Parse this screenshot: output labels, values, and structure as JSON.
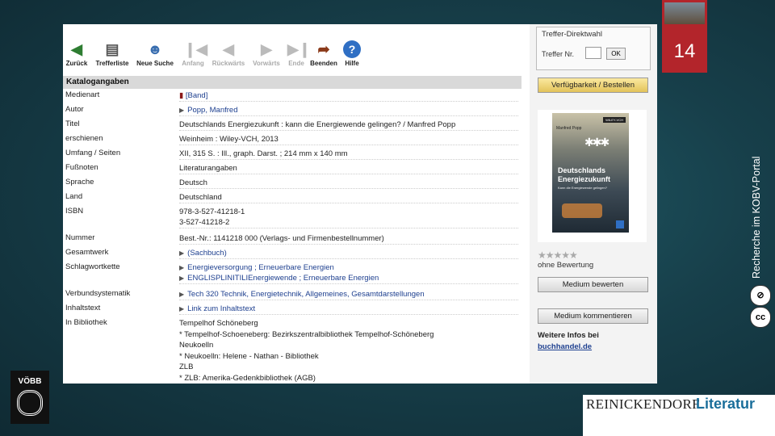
{
  "slide": {
    "number": "14",
    "vertical_text": "Recherche im KOBV-Portal",
    "voebb_logo": "VÖBB",
    "brand": {
      "name": "REINICKENDORF",
      "word": "Literatur",
      "name_color": "#222222",
      "word_color": "#1a6e9a"
    }
  },
  "toolbar": {
    "items": [
      {
        "label": "Zurück",
        "icon": "arrow-left-icon",
        "enabled": true
      },
      {
        "label": "Trefferliste",
        "icon": "list-icon",
        "enabled": true
      },
      {
        "label": "Neue Suche",
        "icon": "people-search-icon",
        "enabled": true
      },
      {
        "label": "Anfang",
        "icon": "first-icon",
        "enabled": false
      },
      {
        "label": "Rückwärts",
        "icon": "prev-icon",
        "enabled": false
      },
      {
        "label": "Vorwärts",
        "icon": "next-icon",
        "enabled": false
      },
      {
        "label": "Ende",
        "icon": "last-icon",
        "enabled": false
      },
      {
        "label": "Beenden",
        "icon": "exit-icon",
        "enabled": true
      },
      {
        "label": "Hilfe",
        "icon": "help-icon",
        "enabled": true
      }
    ]
  },
  "catalog": {
    "heading": "Katalogangaben",
    "rows": [
      {
        "label": "Medienart",
        "values": [
          "[Band]"
        ]
      },
      {
        "label": "Autor",
        "values": [
          "Popp, Manfred"
        ]
      },
      {
        "label": "Titel",
        "values": [
          "Deutschlands Energiezukunft : kann die Energiewende gelingen? / Manfred Popp"
        ]
      },
      {
        "label": "erschienen",
        "values": [
          "Weinheim : Wiley-VCH, 2013"
        ]
      },
      {
        "label": "Umfang / Seiten",
        "values": [
          "XII, 315 S. : Ill., graph. Darst. ; 214 mm x 140 mm"
        ]
      },
      {
        "label": "Fußnoten",
        "values": [
          "Literaturangaben"
        ]
      },
      {
        "label": "Sprache",
        "values": [
          "Deutsch"
        ]
      },
      {
        "label": "Land",
        "values": [
          "Deutschland"
        ]
      },
      {
        "label": "ISBN",
        "values": [
          "978-3-527-41218-1",
          "3-527-41218-2"
        ]
      },
      {
        "label": "Nummer",
        "values": [
          "Best.-Nr.: 1141218 000   (Verlags- und Firmenbestellnummer)"
        ]
      },
      {
        "label": "Gesamtwerk",
        "values": [
          "(Sachbuch)"
        ]
      },
      {
        "label": "Schlagwortkette",
        "values": [
          "Energieversorgung ; Erneuerbare Energien",
          "ENGLISPLINITILIEnergiewende ; Erneuerbare Energien"
        ]
      },
      {
        "label": "Verbundsystematik",
        "values": [
          "Tech 320 Technik, Energietechnik, Allgemeines, Gesamtdarstellungen"
        ]
      },
      {
        "label": "Inhaltstext",
        "values": [
          "Link zum Inhaltstext"
        ]
      },
      {
        "label": "In Bibliothek",
        "values": [
          "Tempelhof Schöneberg",
          "* Tempelhof-Schoeneberg: Bezirkszentralbibliothek Tempelhof-Schöneberg",
          "Neukoelln",
          "* Neukoelln: Helene - Nathan - Bibliothek",
          "ZLB",
          "* ZLB: Amerika-Gedenkbibliothek (AGB)"
        ]
      }
    ]
  },
  "sidebar": {
    "direct_title": "Treffer-Direktwahl",
    "direct_label": "Treffer Nr.",
    "ok_label": "OK",
    "availability_button": "Verfügbarkeit / Bestellen",
    "cover": {
      "publisher": "WILEY-VCH",
      "author": "Manfred Popp",
      "title_line1": "Deutschlands",
      "title_line2": "Energiezukunft",
      "subtitle": "Kann die Energiewende gelingen?"
    },
    "rating_text": "ohne Bewertung",
    "rate_button": "Medium bewerten",
    "comment_button": "Medium kommentieren",
    "more_info": "Weitere Infos bei",
    "more_info_link": "buchhandel.de"
  }
}
